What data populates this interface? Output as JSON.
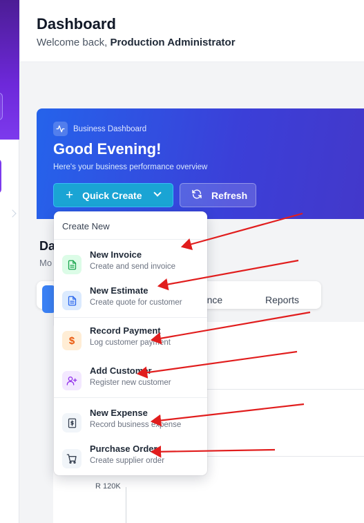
{
  "header": {
    "title": "Dashboard",
    "welcome_prefix": "Welcome back, ",
    "user_name": "Production Administrator"
  },
  "hero": {
    "tag": "Business Dashboard",
    "greeting": "Good Evening!",
    "subtitle": "Here's your business performance overview",
    "quick_create_label": "Quick Create",
    "refresh_label": "Refresh"
  },
  "content": {
    "section_title": "Da",
    "section_subtitle": "Mo",
    "tabs": [
      "nance",
      "Reports"
    ],
    "chart_ylabel": "R 120K"
  },
  "menu": {
    "heading": "Create New",
    "items": [
      {
        "title": "New Invoice",
        "desc": "Create and send invoice",
        "icon": "document-icon",
        "color": "#16a34a",
        "bg": "#dcfce7"
      },
      {
        "title": "New Estimate",
        "desc": "Create quote for customer",
        "icon": "document-icon",
        "color": "#2563eb",
        "bg": "#dbeafe"
      },
      {
        "title": "Record Payment",
        "desc": "Log customer payment",
        "icon": "dollar-icon",
        "color": "#ea580c",
        "bg": "#ffedd5"
      },
      {
        "title": "Add Customer",
        "desc": "Register new customer",
        "icon": "user-plus-icon",
        "color": "#9333ea",
        "bg": "#f3e8ff"
      },
      {
        "title": "New Expense",
        "desc": "Record business expense",
        "icon": "receipt-icon",
        "color": "#374151",
        "bg": "#f1f5f9"
      },
      {
        "title": "Purchase Order",
        "desc": "Create supplier order",
        "icon": "cart-icon",
        "color": "#374151",
        "bg": "#f1f5f9"
      }
    ]
  },
  "colors": {
    "hero_start": "#2563eb",
    "hero_end": "#4338ca",
    "quick_create": "#1aa4d4",
    "annotation_arrow": "#e11d1d"
  }
}
